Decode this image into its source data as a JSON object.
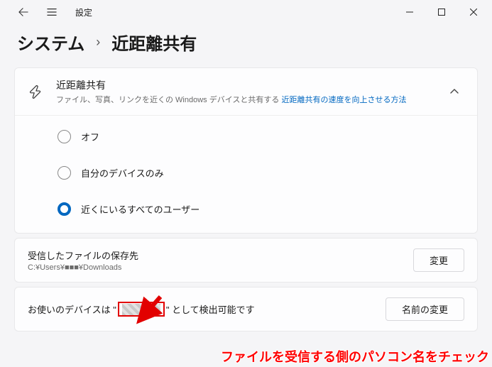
{
  "titlebar": {
    "settings": "設定"
  },
  "breadcrumb": {
    "parent": "システム",
    "current": "近距離共有"
  },
  "share": {
    "title": "近距離共有",
    "desc_prefix": "ファイル、写真、リンクを近くの Windows デバイスと共有する ",
    "desc_link": "近距離共有の速度を向上させる方法",
    "options": {
      "off": "オフ",
      "mine": "自分のデバイスのみ",
      "everyone": "近くにいるすべてのユーザー"
    }
  },
  "save": {
    "title": "受信したファイルの保存先",
    "path": "C:¥Users¥■■■¥Downloads",
    "button": "変更"
  },
  "device": {
    "prefix": "お使いのデバイスは \"",
    "suffix": "\" として検出可能です",
    "button": "名前の変更"
  },
  "annotation": "ファイルを受信する側のパソコン名をチェック"
}
